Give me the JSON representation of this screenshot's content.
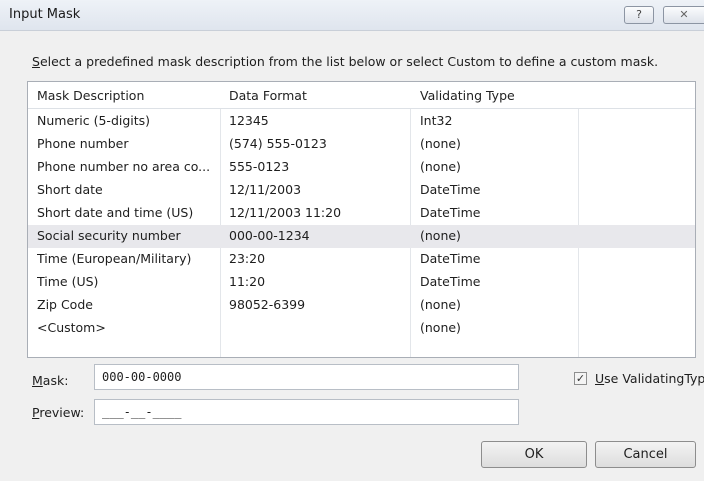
{
  "window": {
    "title": "Input Mask",
    "help_glyph": "?",
    "close_glyph": "✕"
  },
  "instructions": {
    "accel": "S",
    "rest": "elect a predefined mask description from the list below or select Custom to define a custom mask."
  },
  "list": {
    "headers": [
      "Mask Description",
      "Data Format",
      "Validating Type"
    ],
    "selected_index": 5,
    "rows": [
      {
        "description": "Numeric (5-digits)",
        "format": "12345",
        "type": "Int32"
      },
      {
        "description": "Phone number",
        "format": "(574) 555-0123",
        "type": "(none)"
      },
      {
        "description": "Phone number no area co...",
        "format": "555-0123",
        "type": "(none)"
      },
      {
        "description": "Short date",
        "format": "12/11/2003",
        "type": "DateTime"
      },
      {
        "description": "Short date and time (US)",
        "format": "12/11/2003 11:20",
        "type": "DateTime"
      },
      {
        "description": "Social security number",
        "format": "000-00-1234",
        "type": "(none)"
      },
      {
        "description": "Time (European/Military)",
        "format": "23:20",
        "type": "DateTime"
      },
      {
        "description": "Time (US)",
        "format": "11:20",
        "type": "DateTime"
      },
      {
        "description": "Zip Code",
        "format": "98052-6399",
        "type": "(none)"
      },
      {
        "description": "<Custom>",
        "format": "",
        "type": "(none)"
      }
    ]
  },
  "mask": {
    "label_accel": "M",
    "label_rest": "ask:",
    "value": "000-00-0000"
  },
  "preview": {
    "label_accel": "P",
    "label_rest": "review:",
    "value": "___-__-____"
  },
  "validating": {
    "checked": true,
    "check_glyph": "✓",
    "label_accel": "U",
    "label_rest": "se ValidatingType"
  },
  "buttons": {
    "ok": "OK",
    "cancel": "Cancel"
  }
}
